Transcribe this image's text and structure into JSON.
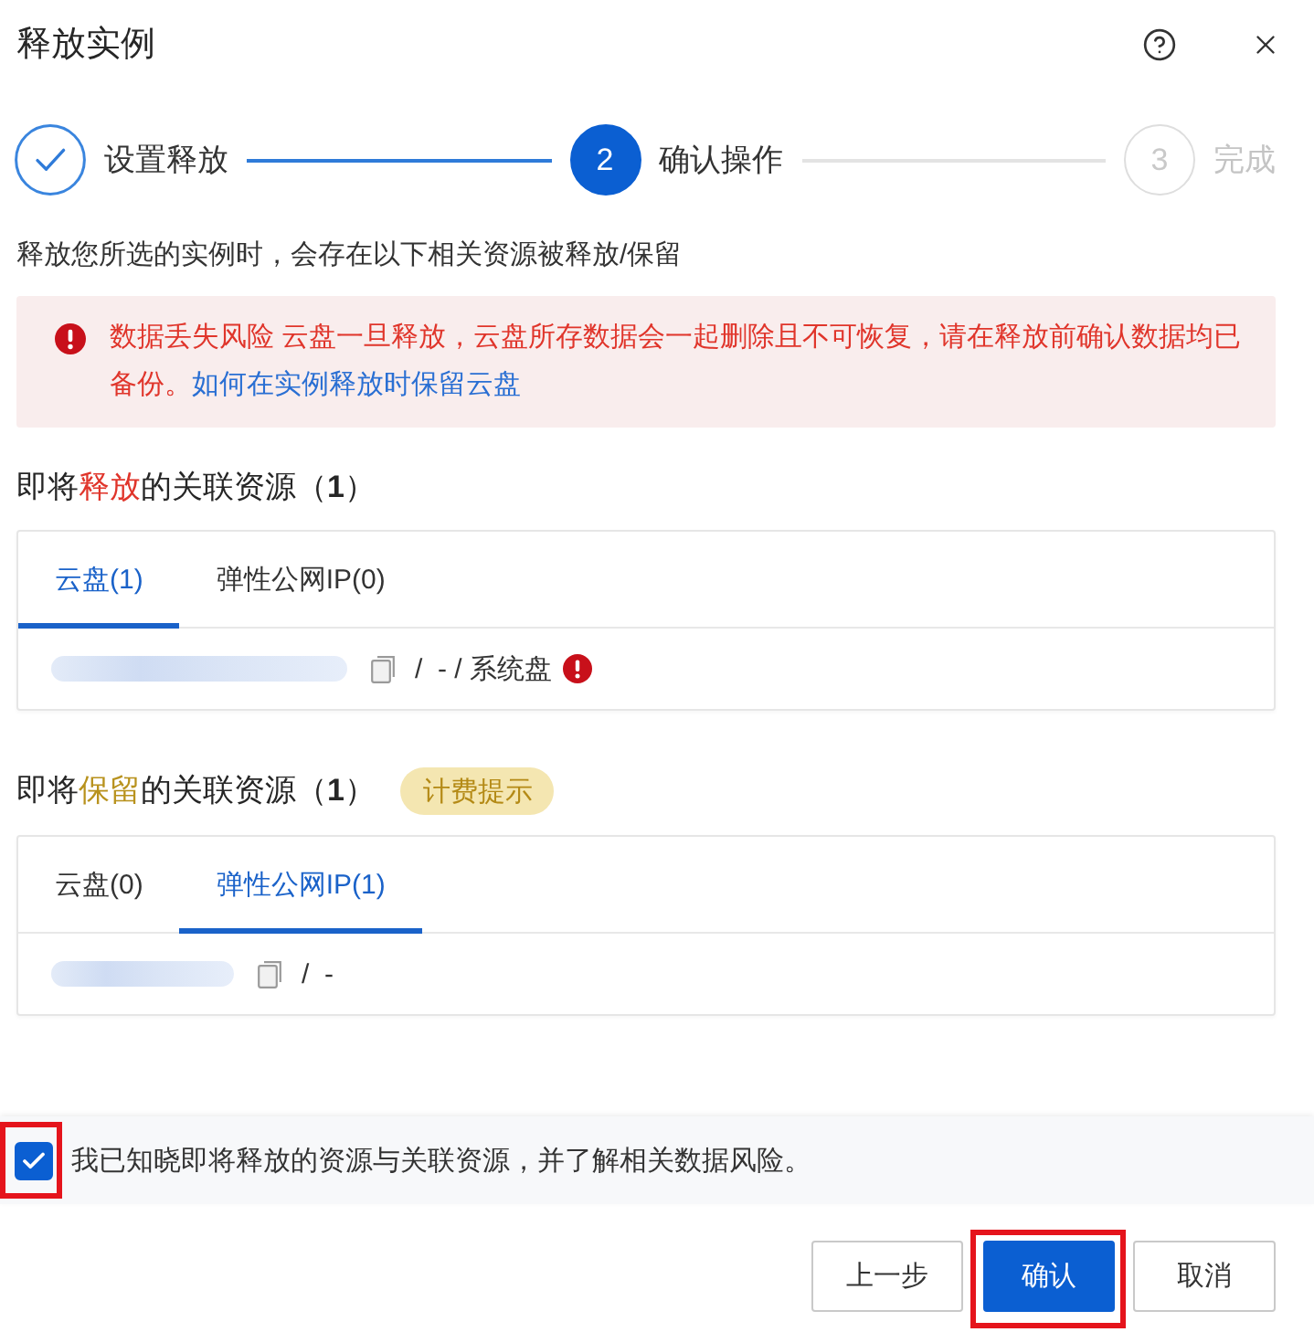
{
  "dialog": {
    "title": "释放实例"
  },
  "steps": [
    {
      "completed": true,
      "selected": false,
      "label": "设置释放"
    },
    {
      "completed": false,
      "selected": true,
      "number": "2",
      "label": "确认操作"
    },
    {
      "completed": false,
      "selected": false,
      "number": "3",
      "label": "完成"
    }
  ],
  "description": "释放您所选的实例时，会存在以下相关资源被释放/保留",
  "alert": {
    "text": "数据丢失风险 云盘一旦释放，云盘所存数据会一起删除且不可恢复，请在释放前确认数据均已备份。",
    "link": "如何在实例释放时保留云盘"
  },
  "sections": [
    {
      "kind": "release",
      "heading": {
        "prefix": "即将",
        "emphasis": "释放",
        "suffix": "的关联资源（**1**）"
      },
      "tabs": [
        {
          "label": "云盘(1)",
          "selected": true
        },
        {
          "label": "弹性公网IP(0)",
          "selected": false
        }
      ],
      "rows": [
        {
          "path": "/  - / 系统盘",
          "warning": true
        }
      ]
    },
    {
      "kind": "retain",
      "heading": {
        "prefix": "即将",
        "emphasis": "保留",
        "suffix": "的关联资源（**1**）"
      },
      "badge": "计费提示",
      "tabs": [
        {
          "label": "云盘(0)",
          "selected": false
        },
        {
          "label": "弹性公网IP(1)",
          "selected": true
        }
      ],
      "rows": [
        {
          "path": "/  -",
          "warning": false
        }
      ]
    }
  ],
  "acknowledge": {
    "checked": true,
    "highlighted": true,
    "label": "我已知晓即将释放的资源与关联资源，并了解相关数据风险。"
  },
  "buttons": [
    {
      "kind": "secondary",
      "label": "上一步",
      "highlighted": false
    },
    {
      "kind": "primary",
      "label": "确认",
      "highlighted": true
    },
    {
      "kind": "secondary",
      "label": "取消",
      "highlighted": false
    }
  ]
}
